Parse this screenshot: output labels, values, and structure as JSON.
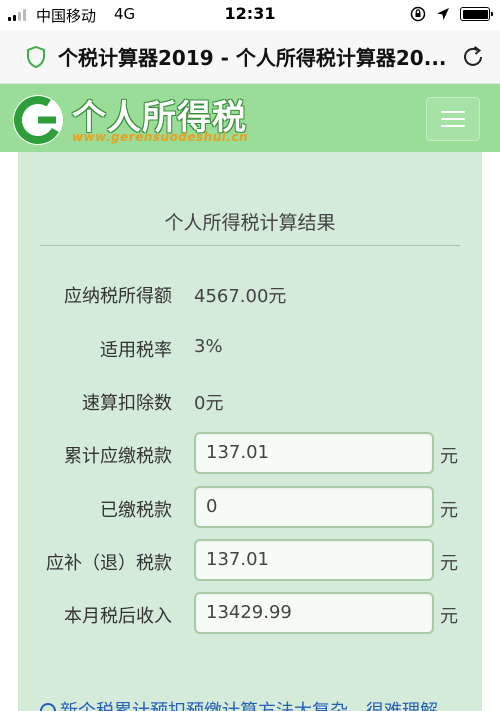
{
  "status": {
    "carrier": "中国移动",
    "network": "4G",
    "time": "12:31"
  },
  "browser": {
    "page_title": "个税计算器2019 - 个人所得税计算器20..."
  },
  "site": {
    "logo_text": "个人所得税",
    "logo_url": "www.gerensuodeshui.cn"
  },
  "result": {
    "title": "个人所得税计算结果",
    "rows": [
      {
        "label": "应纳税所得额",
        "value": "4567.00元"
      },
      {
        "label": "适用税率",
        "value": "3%"
      },
      {
        "label": "速算扣除数",
        "value": "0元"
      }
    ],
    "fields": [
      {
        "label": "累计应缴税款",
        "value": "137.01",
        "unit": "元"
      },
      {
        "label": "已缴税款",
        "value": "0",
        "unit": "元"
      },
      {
        "label": "应补（退）税款",
        "value": "137.01",
        "unit": "元"
      },
      {
        "label": "本月税后收入",
        "value": "13429.99",
        "unit": "元"
      }
    ]
  },
  "bottom_link": {
    "text": "新个税累计预扣预缴计算方法太复杂，很难理解"
  }
}
